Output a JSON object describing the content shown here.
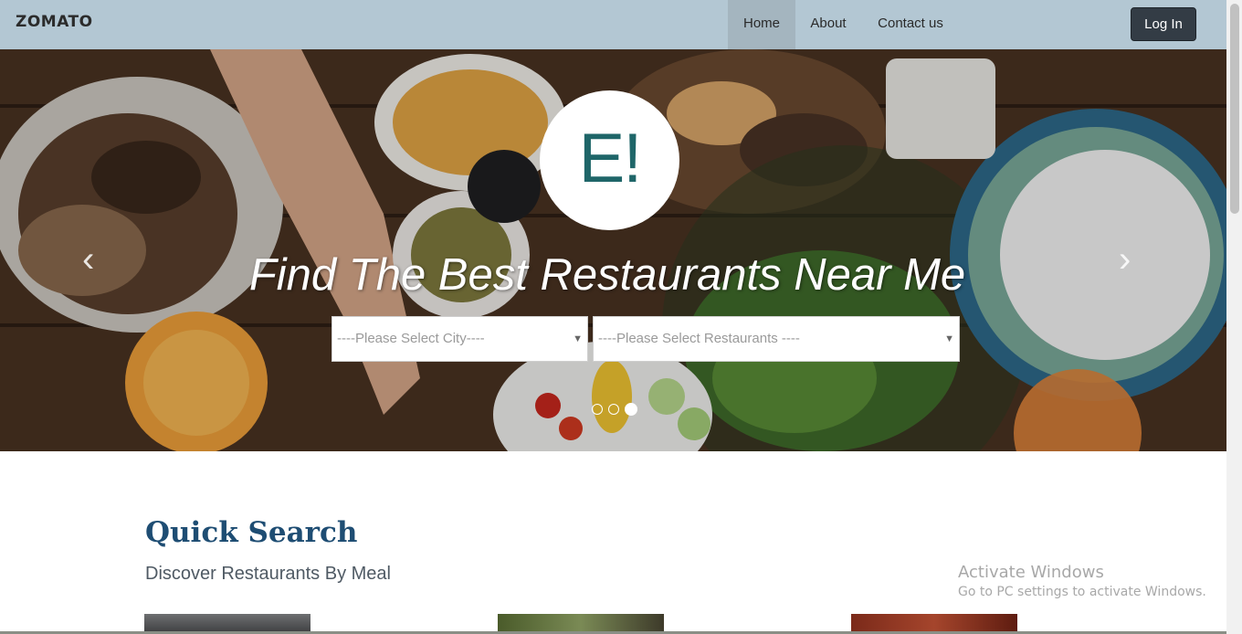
{
  "navbar": {
    "brand": "ZOMATO",
    "items": [
      {
        "label": "Home",
        "active": true
      },
      {
        "label": "About"
      },
      {
        "label": "Contact us"
      }
    ],
    "login_label": "Log In"
  },
  "hero": {
    "logo_text": "E!",
    "heading": "Find The Best Restaurants Near Me",
    "city_select": {
      "value": "----Please Select City----"
    },
    "restaurant_select": {
      "value": "----Please Select Restaurants ----"
    },
    "carousel": {
      "slide_count": 3,
      "active_index": 2,
      "prev_icon": "chevron-left-icon",
      "next_icon": "chevron-right-icon"
    }
  },
  "quick_search": {
    "title": "Quick Search",
    "subtitle": "Discover Restaurants By Meal"
  },
  "watermark": {
    "title": "Activate Windows",
    "subtitle": "Go to PC settings to activate Windows."
  },
  "colors": {
    "navbar": "#b3c7d3",
    "login_button": "#333c45",
    "logo_text": "#1f6669",
    "quick_search_title": "#1e4d73"
  }
}
